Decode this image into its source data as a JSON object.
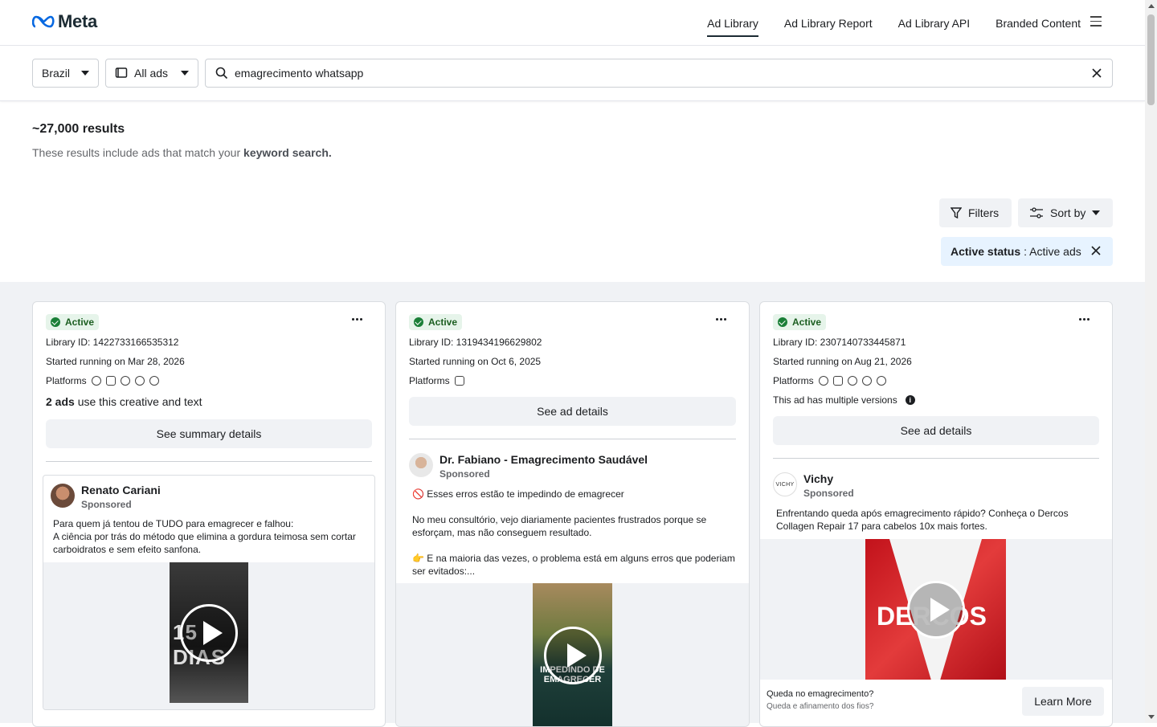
{
  "header": {
    "logo_text": "Meta",
    "nav": [
      "Ad Library",
      "Ad Library Report",
      "Ad Library API",
      "Branded Content"
    ]
  },
  "search": {
    "country": "Brazil",
    "ad_type": "All ads",
    "query": "emagrecimento whatsapp"
  },
  "results": {
    "count": "~27,000 results",
    "note_prefix": "These results include ads that match your",
    "note_bold": "keyword search."
  },
  "toolbar": {
    "filters_label": "Filters",
    "sort_label": "Sort by",
    "chip_key": "Active status",
    "chip_value": ": Active ads"
  },
  "cards": [
    {
      "status": "Active",
      "library_id": "Library ID: 1422733166535312",
      "started": "Started running on Mar 28, 2026",
      "platforms_label": "Platforms",
      "extra_bold": "2 ads",
      "extra_rest": " use this creative and text",
      "button": "See summary details",
      "advertiser": "Renato Cariani",
      "sponsored": "Sponsored",
      "text": "Para quem já tentou de TUDO para emagrecer e falhou:\nA ciência por trás do método que elimina a gordura teimosa sem cortar carboidratos e sem efeito sanfona.",
      "video_overlay": "15 DIAS"
    },
    {
      "status": "Active",
      "library_id": "Library ID: 1319434196629802",
      "started": "Started running on Oct 6, 2025",
      "platforms_label": "Platforms",
      "button": "See ad details",
      "advertiser": "Dr. Fabiano - Emagrecimento Saudável",
      "sponsored": "Sponsored",
      "text": "🚫 Esses erros estão te impedindo de emagrecer\n\nNo meu consultório, vejo diariamente pacientes frustrados porque se esforçam, mas não conseguem resultado.\n\n👉 E na maioria das vezes, o problema está em alguns erros que poderiam ser evitados:...",
      "video_overlay": "IMPEDINDO DE EMAGRECER"
    },
    {
      "status": "Active",
      "library_id": "Library ID: 2307140733445871",
      "started": "Started running on Aug 21, 2026",
      "platforms_label": "Platforms",
      "extra": "This ad has multiple versions",
      "button": "See ad details",
      "advertiser": "Vichy",
      "avatar_text": "VICHY",
      "sponsored": "Sponsored",
      "text": "Enfrentando queda após emagrecimento rápido? Conheça o Dercos Collagen Repair 17 para cabelos 10x mais fortes.",
      "video_overlay": "DERCOS",
      "cta_title": "Queda no emagrecimento?",
      "cta_sub": "Queda e afinamento dos fios?",
      "cta_button": "Learn More"
    }
  ]
}
